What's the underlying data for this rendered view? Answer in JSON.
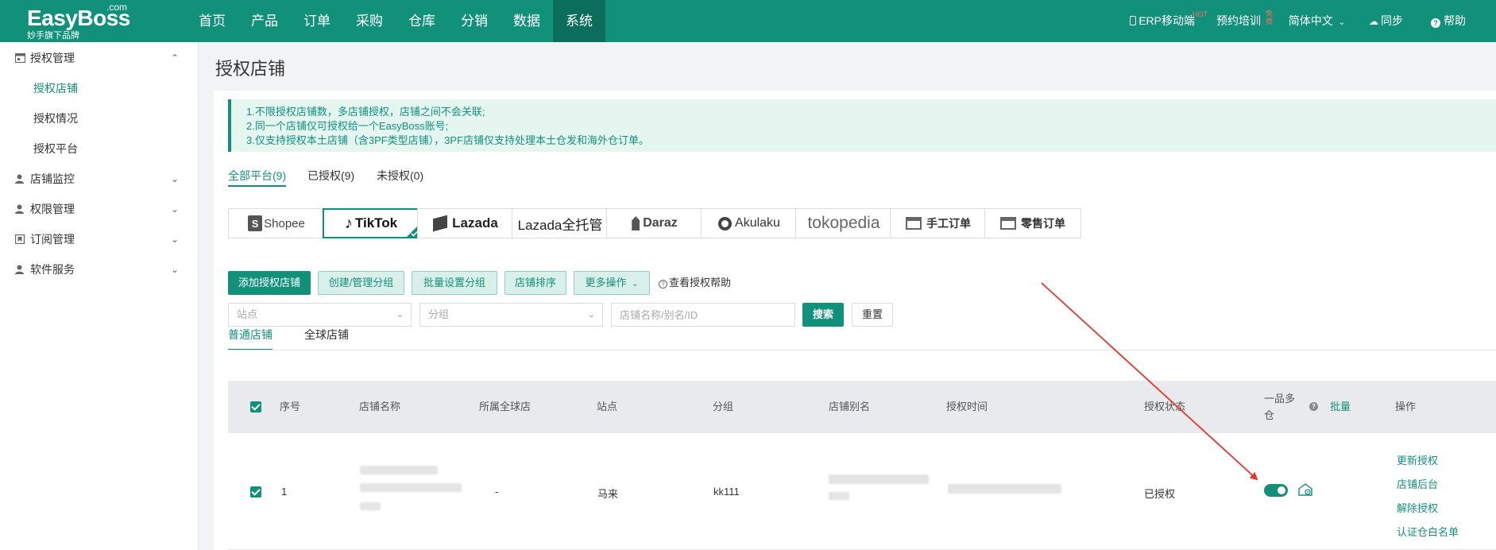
{
  "app": {
    "logo": "EasyBoss",
    "logo_suffix": ".com",
    "logo_sub": "妙手旗下品牌"
  },
  "nav": [
    "首页",
    "产品",
    "订单",
    "采购",
    "仓库",
    "分销",
    "数据",
    "系统"
  ],
  "topright": {
    "mobile": "ERP移动端",
    "mobile_badge": "HOT",
    "training": "预约培训",
    "training_badge": "免费",
    "language": "简体中文",
    "sync": "同步",
    "help": "帮助"
  },
  "sidebar": {
    "auth_group": "授权管理",
    "auth_items": [
      "授权店铺",
      "授权情况",
      "授权平台"
    ],
    "groups": [
      "店铺监控",
      "权限管理",
      "订阅管理",
      "软件服务"
    ]
  },
  "page": {
    "title": "授权店铺",
    "notices": [
      "1.不限授权店铺数，多店铺授权，店铺之间不会关联;",
      "2.同一个店铺仅可授权给一个EasyBoss账号;",
      "3.仅支持授权本土店铺（含3PF类型店铺），3PF店铺仅支持处理本土仓发和海外仓订单。"
    ],
    "platform_tabs": [
      "全部平台(9)",
      "已授权(9)",
      "未授权(0)"
    ],
    "platforms": [
      "Shopee",
      "TikTok",
      "Lazada",
      "Lazada全托管",
      "Daraz",
      "Akulaku",
      "tokopedia",
      "手工订单",
      "零售订单"
    ]
  },
  "toolbar": {
    "add": "添加授权店铺",
    "create_group": "创建/管理分组",
    "batch_group": "批量设置分组",
    "sort": "店铺排序",
    "more": "更多操作",
    "help": "查看授权帮助"
  },
  "filters": {
    "site_placeholder": "站点",
    "group_placeholder": "分组",
    "search_placeholder": "店铺名称/别名/ID",
    "search": "搜索",
    "reset": "重置"
  },
  "store_tabs": [
    "普通店铺",
    "全球店铺"
  ],
  "table": {
    "headers": {
      "index": "序号",
      "name": "店铺名称",
      "global": "所属全球店",
      "site": "站点",
      "group": "分组",
      "alias": "店铺别名",
      "time": "授权时间",
      "status": "授权状态",
      "multi_line1": "一品多",
      "multi_line2": "仓",
      "batch": "批量",
      "ops": "操作"
    },
    "rows": [
      {
        "index": "1",
        "global": "-",
        "site": "马来",
        "group": "kk111",
        "status": "已授权",
        "ops": [
          "更新授权",
          "店铺后台",
          "解除授权",
          "认证仓白名单"
        ]
      }
    ]
  },
  "colors": {
    "primary": "#11917a",
    "annotation_arrow": "#e8352b"
  }
}
